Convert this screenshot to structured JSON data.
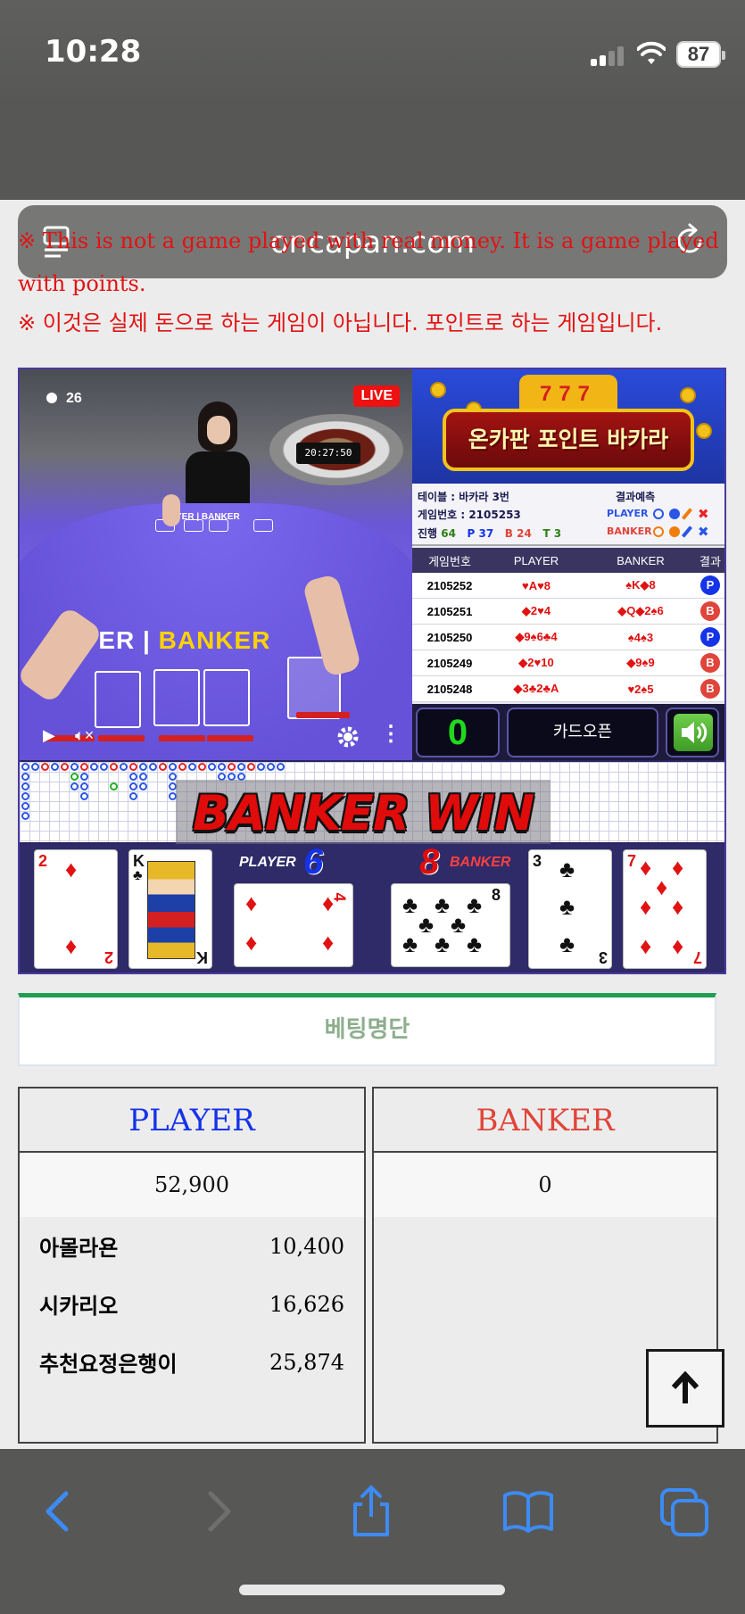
{
  "status_bar": {
    "time": "10:28",
    "battery": "87"
  },
  "browser": {
    "url": "oncapan.com"
  },
  "notice": {
    "english": "※ This is not a game played with real money. It is a game played with points.",
    "korean": "※ 이것은 실제 돈으로 하는 게임이 아닙니다. 포인트로 하는 게임입니다."
  },
  "video": {
    "viewers": "26",
    "live_label": "LIVE",
    "clock": "20:27:50",
    "logo_player": "AYER",
    "logo_banker": "BANKER",
    "small_logo": "YER | BANKER"
  },
  "banner": {
    "title": "온카판 포인트 바카라",
    "slot": "777"
  },
  "table_info": {
    "table": "테이블 : 바카라 3번",
    "game_no": "게임번호 : 2105253",
    "progress_label": "진행",
    "progress": "64",
    "p_label": "P",
    "p_count": "37",
    "b_label": "B",
    "b_count": "24",
    "t_label": "T",
    "t_count": "3",
    "prediction_label": "결과예측",
    "pred_player": "PLAYER",
    "pred_banker": "BANKER"
  },
  "results": {
    "headers": [
      "게임번호",
      "PLAYER",
      "BANKER",
      "결과"
    ],
    "rows": [
      {
        "game": "2105252",
        "player": "♥A♥8",
        "banker": "♠K◆8",
        "result": "P"
      },
      {
        "game": "2105251",
        "player": "◆2♥4",
        "banker": "◆Q◆2♠6",
        "result": "B"
      },
      {
        "game": "2105250",
        "player": "◆9♠6♣4",
        "banker": "♠4♠3",
        "result": "P"
      },
      {
        "game": "2105249",
        "player": "◆2♥10",
        "banker": "◆9♠9",
        "result": "B"
      },
      {
        "game": "2105248",
        "player": "◆3♣2♣A",
        "banker": "♥2♠5",
        "result": "B"
      }
    ]
  },
  "controls": {
    "counter": "0",
    "open_button": "카드오픈"
  },
  "win_banner": "BANKER WIN",
  "hands": {
    "player_label": "PLAYER",
    "player_score": "6",
    "banker_label": "BANKER",
    "banker_score": "8",
    "player_cards": [
      {
        "rank": "2",
        "suit": "♦"
      },
      {
        "rank": "K",
        "suit": "♣"
      },
      {
        "rank": "4",
        "suit": "♦"
      }
    ],
    "banker_cards": [
      {
        "rank": "8",
        "suit": "♣"
      },
      {
        "rank": "3",
        "suit": "♣"
      },
      {
        "rank": "7",
        "suit": "♦"
      }
    ]
  },
  "betting": {
    "title": "베팅명단",
    "player": {
      "header": "PLAYER",
      "total": "52,900",
      "entries": [
        {
          "name": "아몰라욘",
          "amount": "10,400"
        },
        {
          "name": "시카리오",
          "amount": "16,626"
        },
        {
          "name": "추천요정은행이",
          "amount": "25,874"
        }
      ]
    },
    "banker": {
      "header": "BANKER",
      "total": "0"
    }
  },
  "colors": {
    "player": "#1533e8",
    "banker": "#e0443a",
    "accent_green": "#1d9e54",
    "notice_red": "#e11313"
  }
}
